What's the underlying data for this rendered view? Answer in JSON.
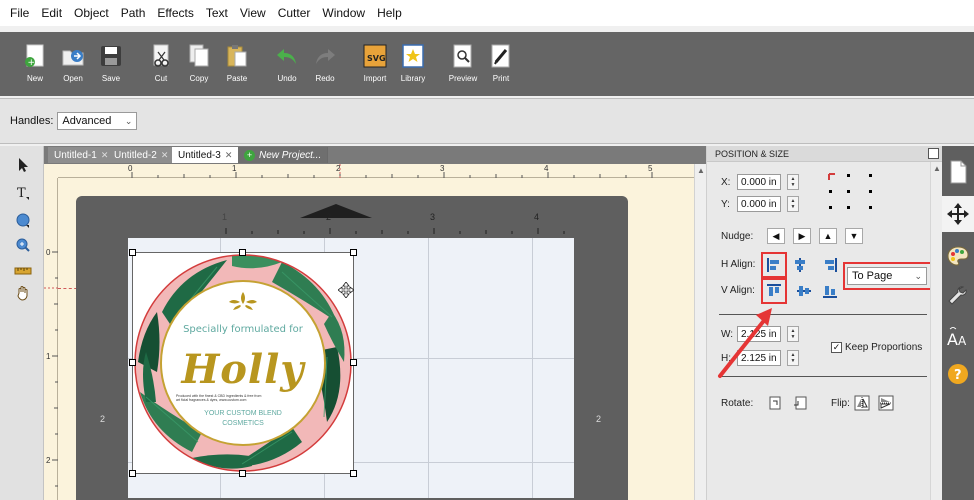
{
  "menubar": {
    "items": [
      "File",
      "Edit",
      "Object",
      "Path",
      "Effects",
      "Text",
      "View",
      "Cutter",
      "Window",
      "Help"
    ]
  },
  "toolbar": {
    "buttons": [
      {
        "label": "New",
        "icon": "new-icon"
      },
      {
        "label": "Open",
        "icon": "open-icon"
      },
      {
        "label": "Save",
        "icon": "save-icon"
      },
      {
        "label": "Cut",
        "icon": "cut-icon"
      },
      {
        "label": "Copy",
        "icon": "copy-icon"
      },
      {
        "label": "Paste",
        "icon": "paste-icon"
      },
      {
        "label": "Undo",
        "icon": "undo-icon"
      },
      {
        "label": "Redo",
        "icon": "redo-icon"
      },
      {
        "label": "Import",
        "icon": "import-svg-icon"
      },
      {
        "label": "Library",
        "icon": "library-icon"
      },
      {
        "label": "Preview",
        "icon": "preview-icon"
      },
      {
        "label": "Print",
        "icon": "print-icon"
      }
    ]
  },
  "handles": {
    "label": "Handles:",
    "value": "Advanced"
  },
  "tabs": [
    {
      "label": "Untitled-1",
      "active": false
    },
    {
      "label": "Untitled-2",
      "active": false
    },
    {
      "label": "Untitled-3",
      "active": true
    },
    {
      "label": "New Project...",
      "active": false
    }
  ],
  "ruler": {
    "top": [
      "0",
      "1",
      "2",
      "3",
      "4",
      "5"
    ],
    "left": [
      "0",
      "1",
      "2"
    ],
    "mat": [
      "1",
      "2",
      "3",
      "4"
    ],
    "mat_side": "2"
  },
  "artwork": {
    "line1": "Specially formulated for",
    "name": "Holly",
    "fine_print": "Produced with the finest & CBD ingredients & free from art ficial fragrances & dyes, www.custom.com",
    "line3": "YOUR CUSTOM BLEND",
    "line4": "COSMETICS"
  },
  "panel": {
    "title": "POSITION & SIZE",
    "x_label": "X:",
    "x_value": "0.000 in",
    "y_label": "Y:",
    "y_value": "0.000 in",
    "nudge_label": "Nudge:",
    "h_align_label": "H Align:",
    "v_align_label": "V Align:",
    "align_to": "To Page",
    "w_label": "W:",
    "w_value": "2.125 in",
    "h_label": "H:",
    "h_value": "2.125 in",
    "keep_proportions": "Keep Proportions",
    "keep_proportions_checked": true,
    "rotate_label": "Rotate:",
    "flip_label": "Flip:"
  },
  "right_strip": {
    "tabs": [
      "page-icon",
      "move-icon",
      "palette-icon",
      "wrench-icon",
      "text-size-icon",
      "help-icon"
    ]
  },
  "colors": {
    "toolbar_bg": "#656565",
    "workspace_bg": "#fbf3dc",
    "mat": "#5f5f5f",
    "highlight": "#e53535",
    "gold": "#b8961f",
    "teal": "#5fa9a0",
    "pink": "#f2b8b8"
  }
}
